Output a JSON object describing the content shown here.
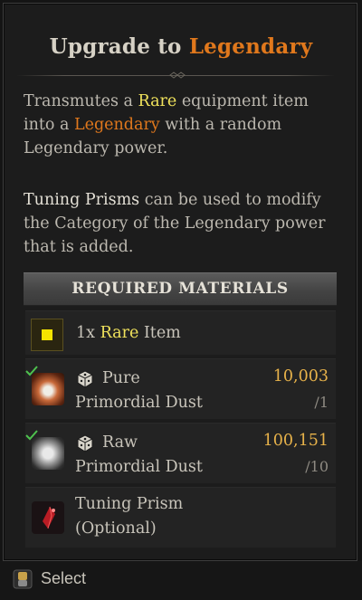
{
  "tooltip": {
    "title_prefix": "Upgrade to ",
    "title_highlight": "Legendary",
    "desc1": {
      "a": "Transmutes a ",
      "rare": "Rare",
      "b": " equipment item into a ",
      "legendary": "Legendary",
      "c": " with a random Legendary power."
    },
    "desc2": {
      "prism": "Tuning Prisms",
      "rest": " can be used to modify the Category of the Legendary power that is added."
    }
  },
  "materials": {
    "header": "REQUIRED MATERIALS",
    "rare_item": {
      "qty": "1x ",
      "rarity": "Rare",
      "name": " Item"
    },
    "pure_dust": {
      "line1": "Pure",
      "line2": "Primordial Dust",
      "owned": "10,003",
      "required": "/1"
    },
    "raw_dust": {
      "line1": "Raw",
      "line2": "Primordial Dust",
      "owned": "100,151",
      "required": "/10"
    },
    "tuning_prism": {
      "line1": "Tuning Prism",
      "line2": "(Optional)"
    }
  },
  "footer": {
    "select_label": "Select"
  },
  "colors": {
    "legendary": "#e0781c",
    "rare": "#f0e25c",
    "count": "#e7b24a",
    "check": "#4ec24e"
  },
  "icons": [
    "check-icon",
    "dice-icon",
    "pure-dust-icon",
    "raw-dust-icon",
    "tuning-prism-icon",
    "select-key-icon",
    "rare-item-icon"
  ]
}
